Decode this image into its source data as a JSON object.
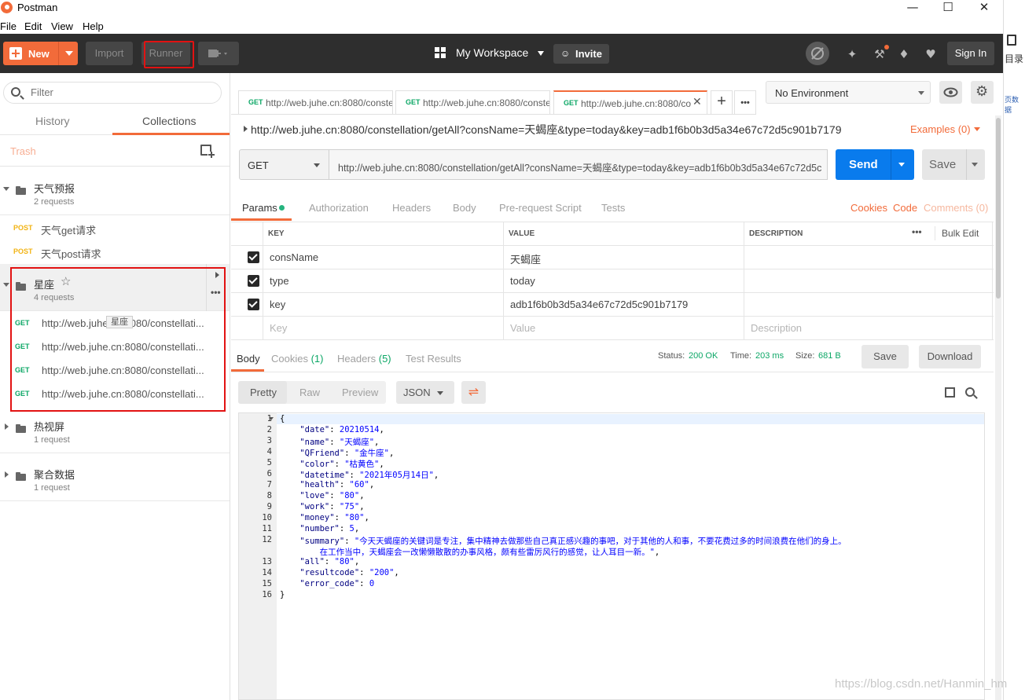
{
  "window": {
    "title": "Postman",
    "minimize": "—",
    "maximize": "☐",
    "close": "✕"
  },
  "menu": [
    "File",
    "Edit",
    "View",
    "Help"
  ],
  "toolbar": {
    "new_label": "New",
    "import_label": "Import",
    "runner_label": "Runner",
    "workspace_label": "My Workspace",
    "invite_label": "Invite",
    "signin_label": "Sign In"
  },
  "sidebar": {
    "filter_placeholder": "Filter",
    "tabs": [
      "History",
      "Collections"
    ],
    "trash_label": "Trash",
    "collections": [
      {
        "name": "天气预报",
        "count": "2 requests"
      },
      {
        "name": "星座",
        "count": "4 requests"
      },
      {
        "name": "热视屏",
        "count": "1 request"
      },
      {
        "name": "聚合数据",
        "count": "1 request"
      }
    ],
    "weather_requests": [
      {
        "method": "POST",
        "name": "天气get请求"
      },
      {
        "method": "POST",
        "name": "天气post请求"
      }
    ],
    "star_requests": [
      {
        "method": "GET",
        "name": "http://web.juhe.cn:8080/constellati..."
      },
      {
        "method": "GET",
        "name": "http://web.juhe.cn:8080/constellati..."
      },
      {
        "method": "GET",
        "name": "http://web.juhe.cn:8080/constellati..."
      },
      {
        "method": "GET",
        "name": "http://web.juhe.cn:8080/constellati..."
      }
    ],
    "tooltip": "星座"
  },
  "tabs": [
    {
      "method": "GET",
      "url": "http://web.juhe.cn:8080/conste"
    },
    {
      "method": "GET",
      "url": "http://web.juhe.cn:8080/conste"
    },
    {
      "method": "GET",
      "url": "http://web.juhe.cn:8080/co"
    }
  ],
  "environment": {
    "selected": "No Environment"
  },
  "request": {
    "title_url": "http://web.juhe.cn:8080/constellation/getAll?consName=天蝎座&type=today&key=adb1f6b0b3d5a34e67c72d5c901b7179",
    "examples": "Examples (0)",
    "method": "GET",
    "url": "http://web.juhe.cn:8080/constellation/getAll?consName=天蝎座&type=today&key=adb1f6b0b3d5a34e67c72d5c901b7179",
    "send": "Send",
    "save": "Save",
    "tabs": [
      "Params",
      "Authorization",
      "Headers",
      "Body",
      "Pre-request Script",
      "Tests"
    ],
    "links": {
      "cookies": "Cookies",
      "code": "Code",
      "comments": "Comments (0)"
    },
    "params_headers": {
      "key": "KEY",
      "value": "VALUE",
      "description": "DESCRIPTION",
      "bulk_edit": "Bulk Edit",
      "more": "•••"
    },
    "params": [
      {
        "key": "consName",
        "value": "天蝎座"
      },
      {
        "key": "type",
        "value": "today"
      },
      {
        "key": "key",
        "value": "adb1f6b0b3d5a34e67c72d5c901b7179"
      }
    ],
    "placeholders": {
      "key": "Key",
      "value": "Value",
      "description": "Description"
    }
  },
  "response": {
    "tabs": [
      "Body",
      "Cookies (1)",
      "Headers (5)",
      "Test Results"
    ],
    "status_label": "Status:",
    "status": "200 OK",
    "time_label": "Time:",
    "time": "203 ms",
    "size_label": "Size:",
    "size": "681 B",
    "save": "Save",
    "download": "Download",
    "views": [
      "Pretty",
      "Raw",
      "Preview"
    ],
    "format": "JSON",
    "lines": [
      {
        "n": "1",
        "t": "{"
      },
      {
        "n": "2",
        "k": "\"date\"",
        "v": "20210514",
        "c": ","
      },
      {
        "n": "3",
        "k": "\"name\"",
        "v": "\"天蝎座\"",
        "c": ","
      },
      {
        "n": "4",
        "k": "\"QFriend\"",
        "v": "\"金牛座\"",
        "c": ","
      },
      {
        "n": "5",
        "k": "\"color\"",
        "v": "\"枯黄色\"",
        "c": ","
      },
      {
        "n": "6",
        "k": "\"datetime\"",
        "v": "\"2021年05月14日\"",
        "c": ","
      },
      {
        "n": "7",
        "k": "\"health\"",
        "v": "\"60\"",
        "c": ","
      },
      {
        "n": "8",
        "k": "\"love\"",
        "v": "\"80\"",
        "c": ","
      },
      {
        "n": "9",
        "k": "\"work\"",
        "v": "\"75\"",
        "c": ","
      },
      {
        "n": "10",
        "k": "\"money\"",
        "v": "\"80\"",
        "c": ","
      },
      {
        "n": "11",
        "k": "\"number\"",
        "v": "5",
        "c": ","
      },
      {
        "n": "12",
        "k": "\"summary\"",
        "v": "\"今天天蝎座的关键词是专注，集中精神去做那些自己真正感兴趣的事吧，对于其他的人和事，不要花费过多的时间浪费在他们的身上。",
        "v2": "在工作当中，天蝎座会一改懒懒散散的办事风格，颇有些雷厉风行的感觉，让人耳目一新。\"",
        "c": ","
      },
      {
        "n": "13",
        "k": "\"all\"",
        "v": "\"80\"",
        "c": ","
      },
      {
        "n": "14",
        "k": "\"resultcode\"",
        "v": "\"200\"",
        "c": ","
      },
      {
        "n": "15",
        "k": "\"error_code\"",
        "v": "0",
        "c": ""
      },
      {
        "n": "16",
        "t": "}"
      }
    ]
  },
  "right_pane": {
    "label": "目录",
    "link": "页数据"
  },
  "watermark": "https://blog.csdn.net/Hanmin_hm"
}
